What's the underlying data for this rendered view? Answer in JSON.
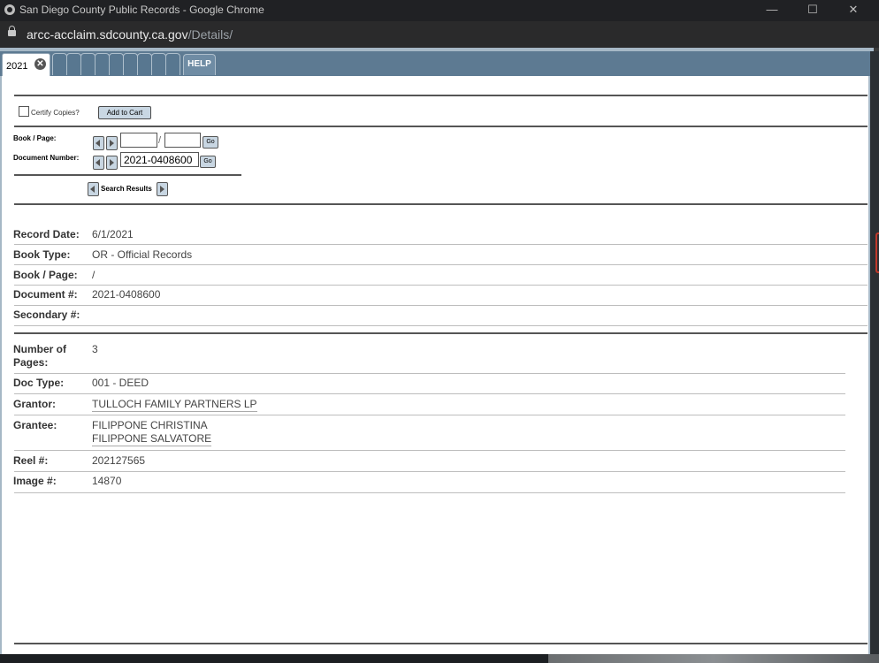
{
  "browser": {
    "window_title": "San Diego County Public Records - Google Chrome",
    "url_domain": "arcc-acclaim.sdcounty.ca.gov",
    "url_path": "/Details/",
    "minimize": "—",
    "maximize": "☐",
    "close": "✕"
  },
  "tabs": {
    "active_label": "2021",
    "close_glyph": "✕",
    "help_label": "HELP"
  },
  "toolbar": {
    "certify_label": "Certify Copies?",
    "add_to_cart": "Add to Cart"
  },
  "nav": {
    "book_page_label": "Book / Page:",
    "book_slash": "/",
    "document_number_label": "Document Number:",
    "document_number_value": "2021-0408600",
    "go": "Go",
    "search_results": "Search Results"
  },
  "record": [
    {
      "label": "Record Date:",
      "value": "6/1/2021"
    },
    {
      "label": "Book Type:",
      "value": "OR - Official Records"
    },
    {
      "label": "Book / Page:",
      "value": "/"
    },
    {
      "label": "Document #:",
      "value": "2021-0408600"
    },
    {
      "label": "Secondary #:",
      "value": ""
    }
  ],
  "details": {
    "pages_label_1": "Number of",
    "pages_label_2": "Pages:",
    "pages_value": "3",
    "doc_type_label": "Doc Type:",
    "doc_type_value": "001 - DEED",
    "grantor_label": "Grantor:",
    "grantor_value": "TULLOCH FAMILY PARTNERS LP",
    "grantee_label": "Grantee:",
    "grantee_1": "FILIPPONE CHRISTINA",
    "grantee_2": "FILIPPONE SALVATORE",
    "reel_label": "Reel #:",
    "reel_value": "202127565",
    "image_label": "Image #:",
    "image_value": "14870"
  }
}
